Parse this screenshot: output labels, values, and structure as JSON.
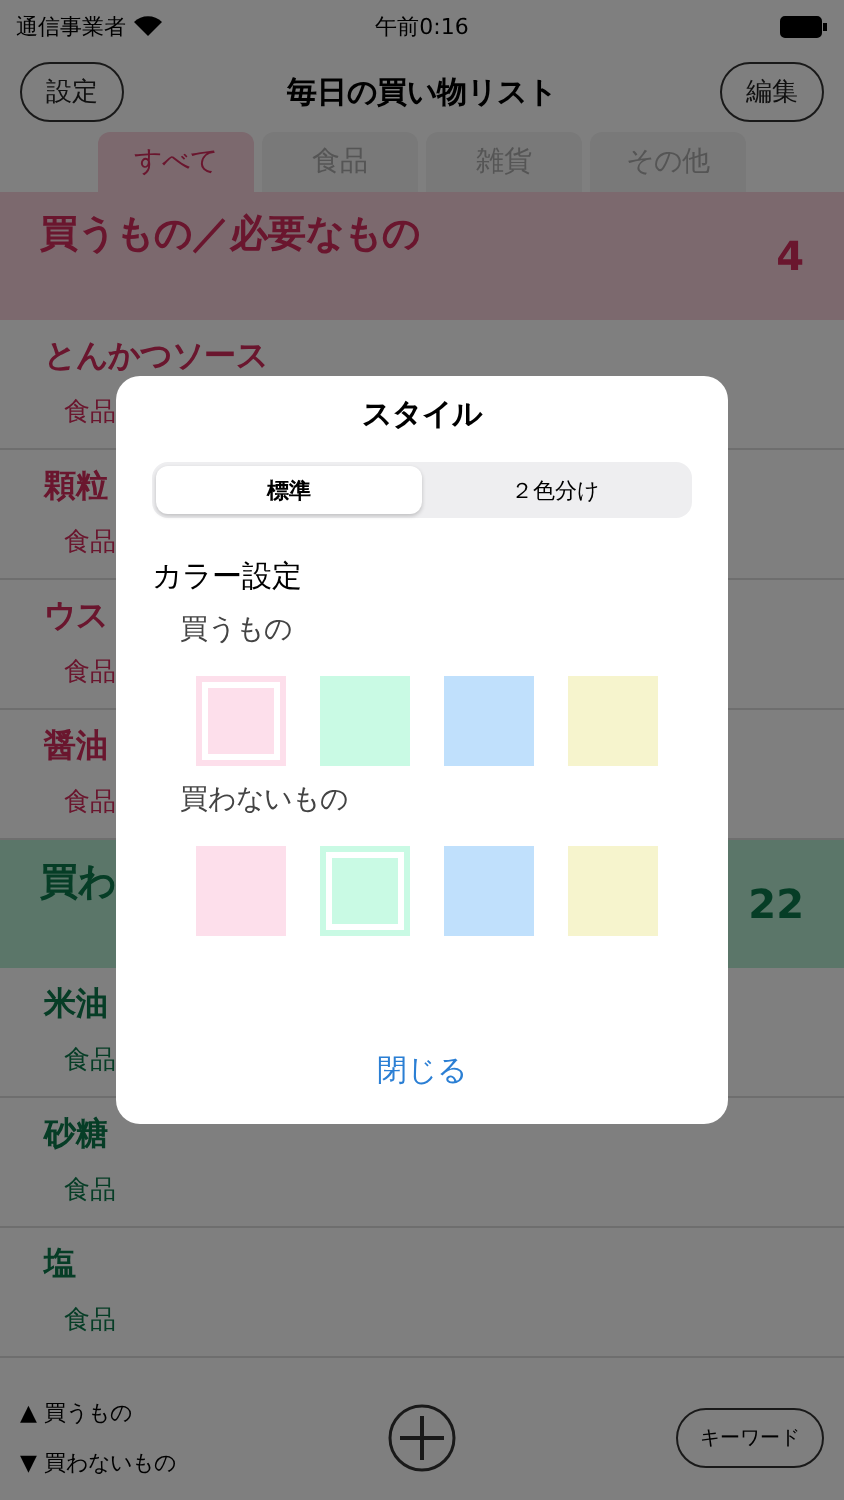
{
  "status_bar": {
    "carrier": "通信事業者",
    "time": "午前0:16"
  },
  "nav": {
    "left_button": "設定",
    "title": "毎日の買い物リスト",
    "right_button": "編集"
  },
  "tabs": [
    {
      "label": "すべて",
      "selected": true
    },
    {
      "label": "食品",
      "selected": false
    },
    {
      "label": "雑貨",
      "selected": false
    },
    {
      "label": "その他",
      "selected": false
    }
  ],
  "sections": [
    {
      "kind": "buy",
      "title": "買うもの／必要なもの",
      "count": "4",
      "items": [
        {
          "name": "とんかつソース",
          "category": "食品"
        },
        {
          "name": "顆粒",
          "category": "食品"
        },
        {
          "name": "ウス",
          "category": "食品"
        },
        {
          "name": "醤油",
          "category": "食品"
        }
      ]
    },
    {
      "kind": "skip",
      "title": "買わ",
      "count": "22",
      "items": [
        {
          "name": "米油",
          "category": "食品"
        },
        {
          "name": "砂糖",
          "category": "食品"
        },
        {
          "name": "塩",
          "category": "食品"
        }
      ]
    }
  ],
  "bottom_bar": {
    "legend": [
      {
        "marker": "▲",
        "label": "買うもの"
      },
      {
        "marker": "▼",
        "label": "買わないもの"
      }
    ],
    "keyword_button": "キーワード"
  },
  "dialog": {
    "title": "スタイル",
    "segments": [
      {
        "label": "標準",
        "selected": true
      },
      {
        "label": "２色分け",
        "selected": false
      }
    ],
    "color_heading": "カラー設定",
    "groups": [
      {
        "label": "買うもの",
        "swatches": [
          {
            "color": "#fddfeb",
            "selected": true
          },
          {
            "color": "#c9fae4",
            "selected": false
          },
          {
            "color": "#c0e0fc",
            "selected": false
          },
          {
            "color": "#f6f4cd",
            "selected": false
          }
        ]
      },
      {
        "label": "買わないもの",
        "swatches": [
          {
            "color": "#fddfeb",
            "selected": false
          },
          {
            "color": "#c9fae4",
            "selected": true
          },
          {
            "color": "#c0e0fc",
            "selected": false
          },
          {
            "color": "#f6f4cd",
            "selected": false
          }
        ]
      }
    ],
    "close_button": "閉じる"
  }
}
